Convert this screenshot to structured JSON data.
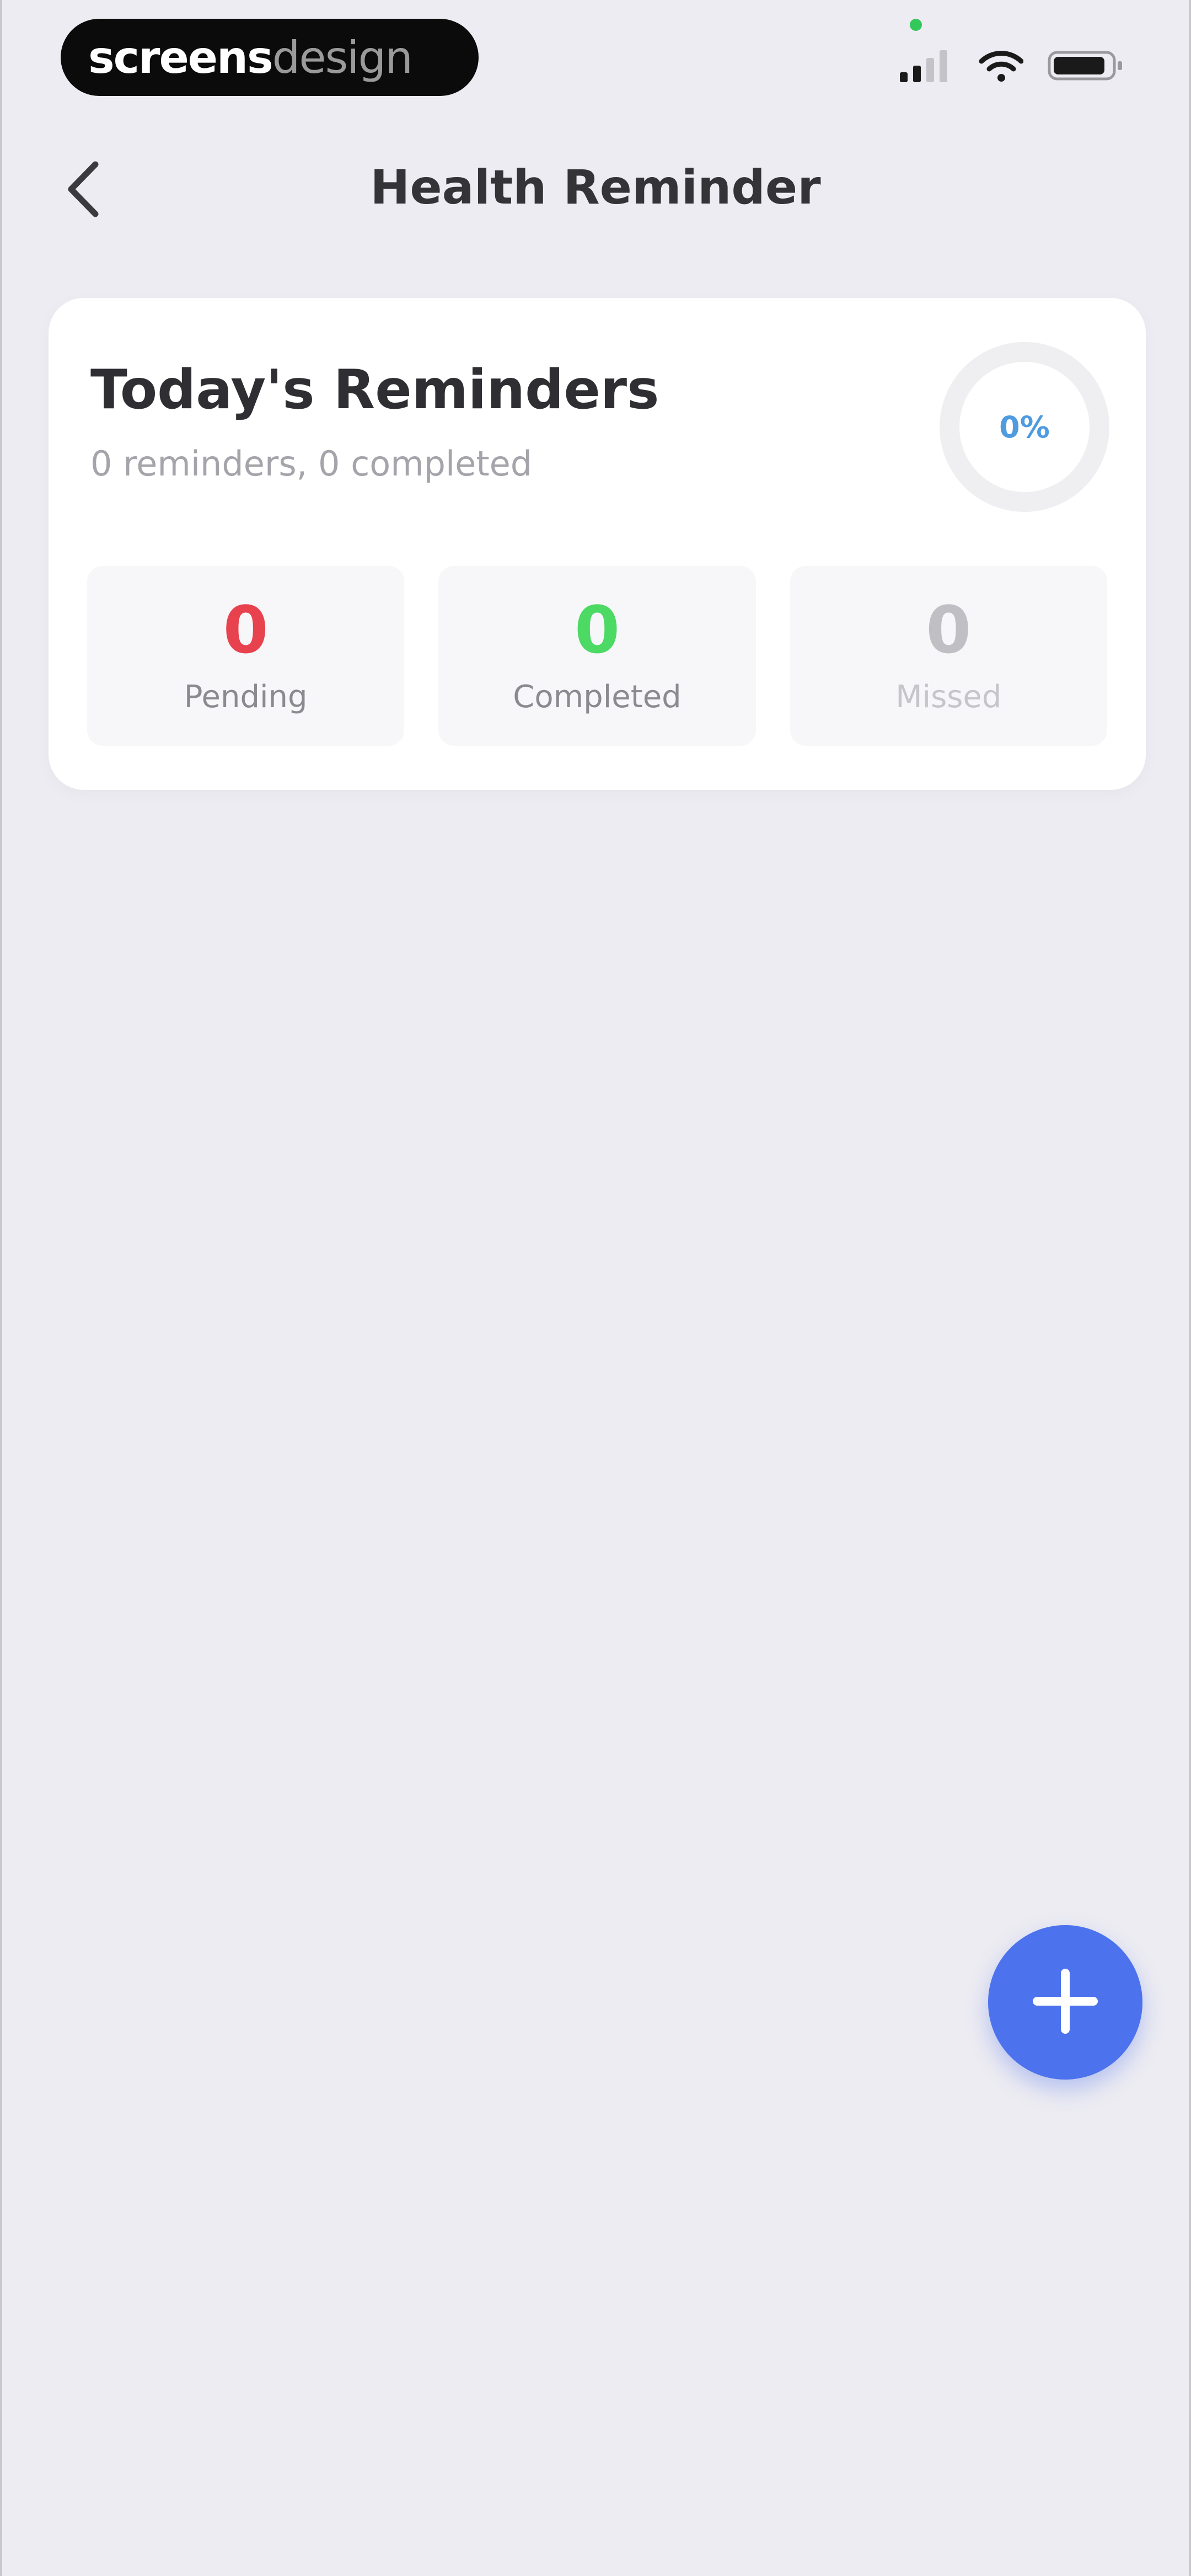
{
  "status_bar": {
    "brand_primary": "screens",
    "brand_secondary": "design",
    "icons": [
      "cellular-signal-icon",
      "wifi-icon",
      "battery-icon"
    ],
    "indicator_color": "#34c759"
  },
  "nav": {
    "title": "Health Reminder",
    "back_icon": "chevron-left-icon"
  },
  "summary": {
    "title": "Today's Reminders",
    "subtitle": "0 reminders, 0 completed",
    "progress_label": "0%",
    "progress_fraction": 0,
    "stats": {
      "pending": {
        "value": "0",
        "label": "Pending",
        "color": "#e8424f"
      },
      "completed": {
        "value": "0",
        "label": "Completed",
        "color": "#4cd964"
      },
      "missed": {
        "value": "0",
        "label": "Missed",
        "color": "#bfbfc4"
      }
    }
  },
  "fab": {
    "icon": "plus-icon",
    "color": "#4c72ee"
  },
  "colors": {
    "background": "#edecf2",
    "card": "#ffffff",
    "accent": "#4f9be0"
  }
}
